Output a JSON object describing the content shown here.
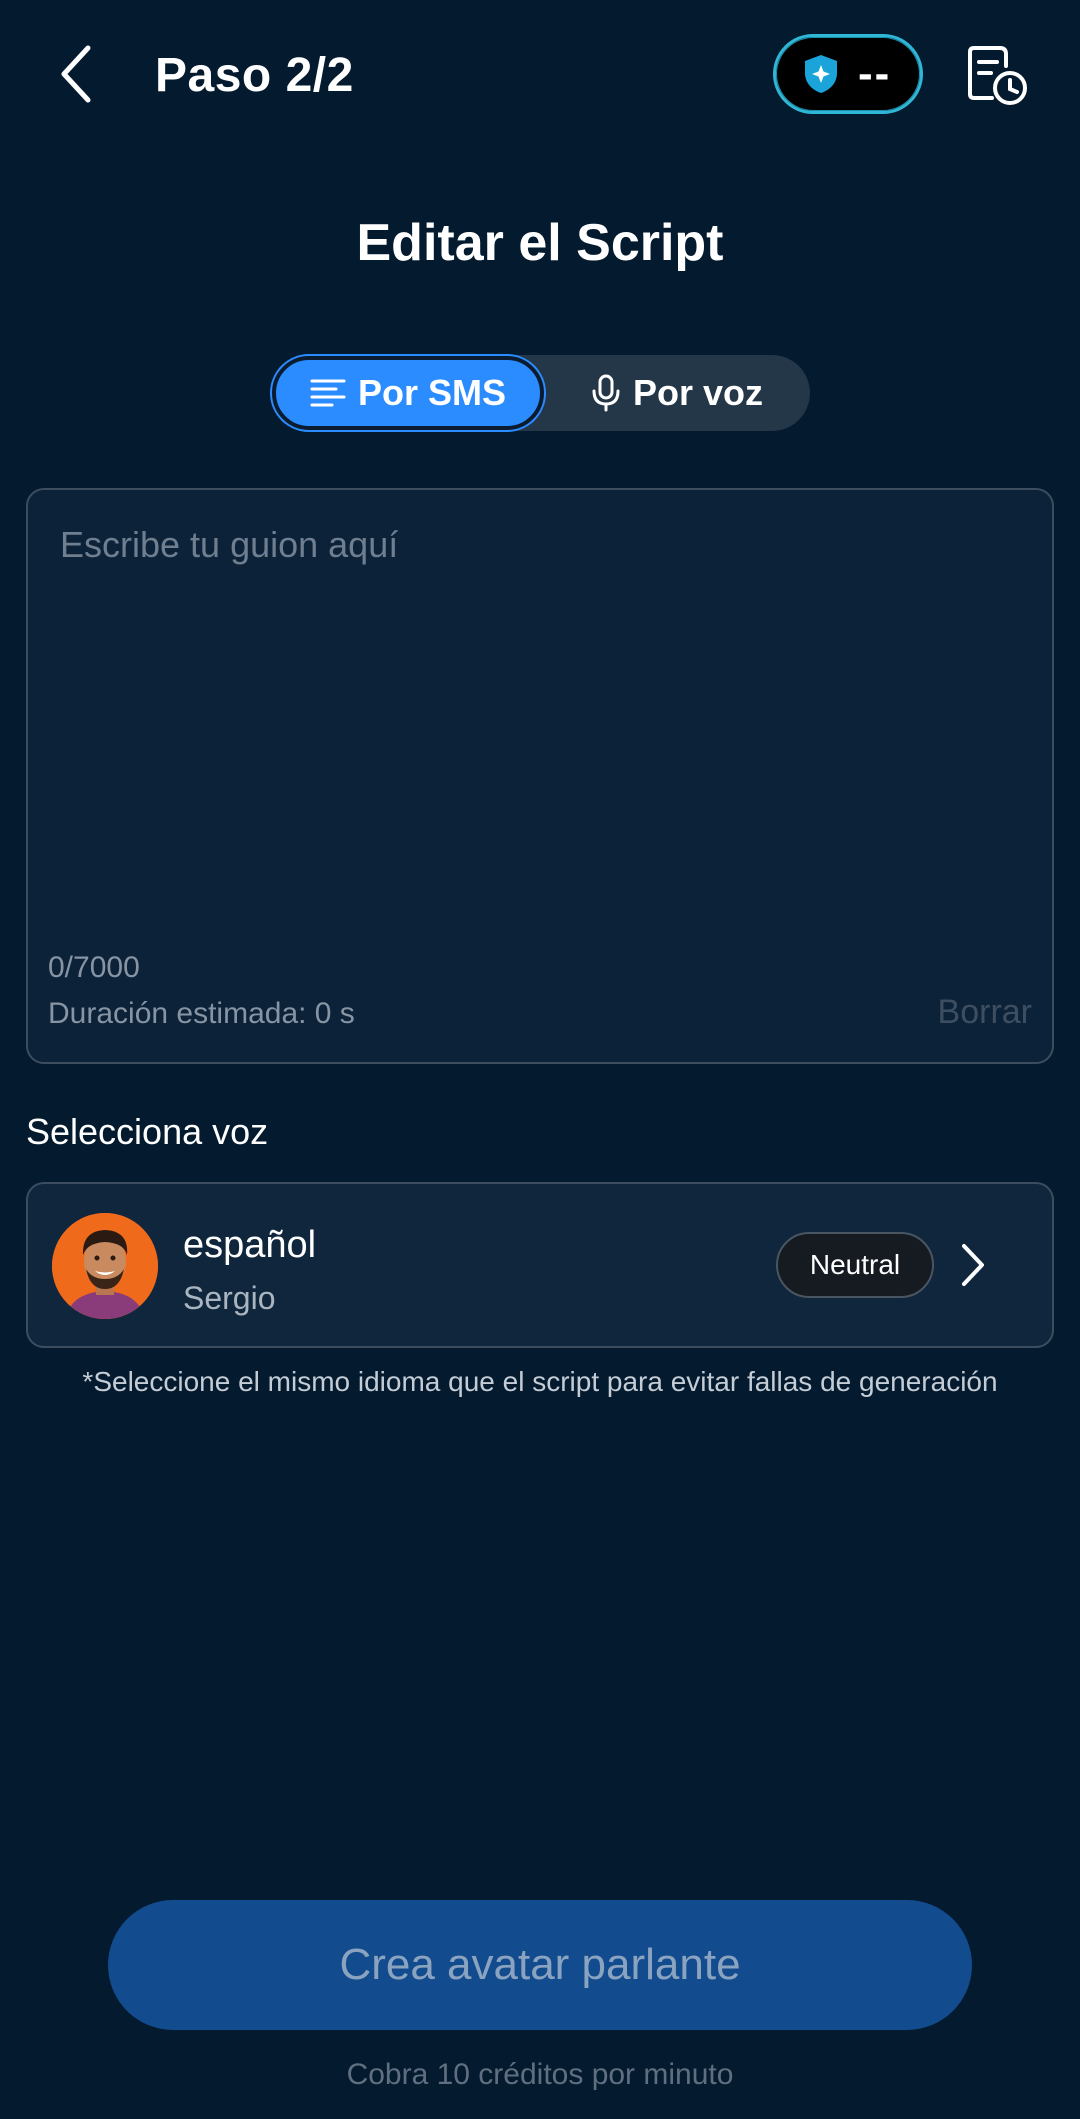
{
  "header": {
    "title": "Paso 2/2",
    "credits": "--",
    "back_icon": "chevron-left-icon",
    "history_icon": "history-icon"
  },
  "page_title": "Editar el Script",
  "mode_toggle": {
    "tabs": [
      {
        "label": "Por SMS",
        "icon": "text-lines-icon",
        "selected": true
      },
      {
        "label": "Por voz",
        "icon": "microphone-icon",
        "selected": false
      }
    ]
  },
  "script": {
    "value": "",
    "placeholder": "Escribe tu guion aquí",
    "char_count": "0/7000",
    "duration": "Duración estimada: 0 s",
    "clear_label": "Borrar"
  },
  "voice": {
    "heading": "Selecciona voz",
    "language": "español",
    "name": "Sergio",
    "style": "Neutral",
    "note": "*Seleccione el mismo idioma que el script para evitar fallas de generación"
  },
  "footer": {
    "create_label": "Crea avatar parlante",
    "cost_note": "Cobra 10 créditos por minuto"
  },
  "colors": {
    "background": "#041a2f",
    "accent": "#2b8cff",
    "button": "#134b8f"
  }
}
